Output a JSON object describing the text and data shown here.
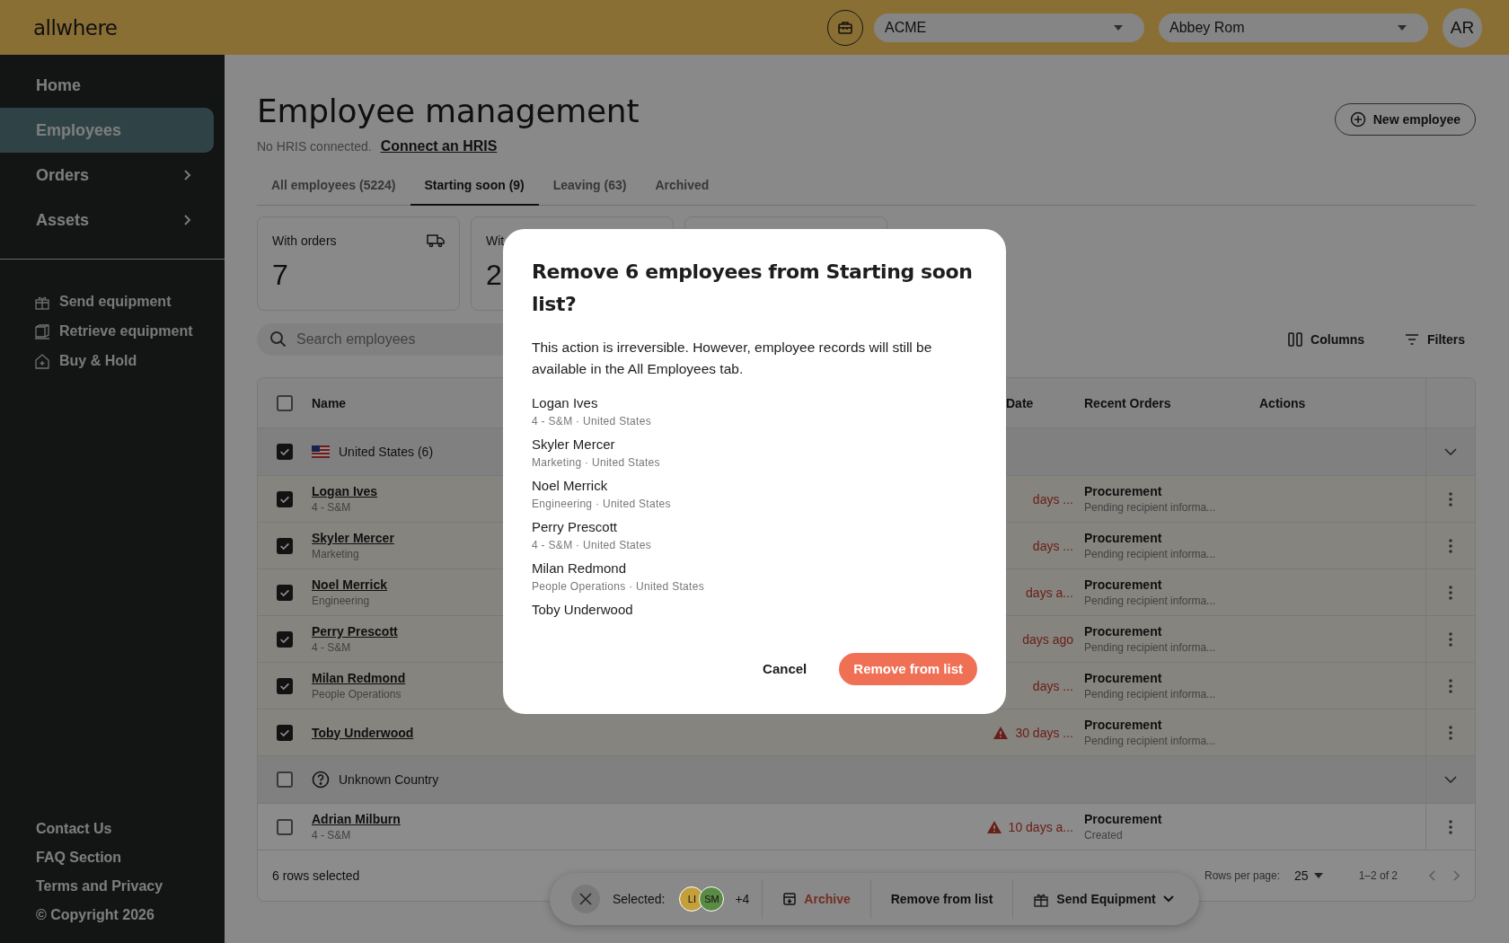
{
  "topbar": {
    "logo": "allwhere",
    "org_select": {
      "value": "ACME"
    },
    "user_select": {
      "value": "Abbey Rom"
    },
    "avatar": "AR"
  },
  "sidebar": {
    "items": [
      {
        "label": "Home",
        "selected": false,
        "expandable": false
      },
      {
        "label": "Employees",
        "selected": true,
        "expandable": false
      },
      {
        "label": "Orders",
        "selected": false,
        "expandable": true
      },
      {
        "label": "Assets",
        "selected": false,
        "expandable": true
      }
    ],
    "links": [
      {
        "label": "Send equipment",
        "kind": "gift"
      },
      {
        "label": "Retrieve equipment",
        "kind": "box"
      },
      {
        "label": "Buy & Hold",
        "kind": "house"
      }
    ],
    "footer_links": [
      "Contact Us",
      "FAQ Section",
      "Terms and Privacy",
      "© Copyright 2026"
    ]
  },
  "page": {
    "title": "Employee management",
    "hris_note": "No HRIS connected.",
    "hris_link": "Connect an HRIS",
    "new_button": "New employee"
  },
  "tabs": [
    {
      "label": "All employees (5224)",
      "selected": false
    },
    {
      "label": "Starting soon (9)",
      "selected": true
    },
    {
      "label": "Leaving (63)",
      "selected": false
    },
    {
      "label": "Archived",
      "selected": false
    }
  ],
  "stat_cards": [
    {
      "kind": "truck",
      "label": "With orders",
      "value": "7"
    },
    {
      "kind": "plain",
      "label": "Wit",
      "value": "2"
    },
    {
      "kind": "covered"
    }
  ],
  "toolbar": {
    "search": {
      "placeholder": "Search employees"
    },
    "columns_button": "Columns",
    "filters_button": "Filters"
  },
  "table": {
    "header_checked": false,
    "columns": [
      {
        "label": "Name"
      },
      {
        "label": "Date"
      },
      {
        "label": "Recent Orders"
      },
      {
        "label": "Actions"
      }
    ],
    "groups": [
      {
        "label": "United States (6)",
        "kind": "flag",
        "checked": true,
        "rows": [
          {
            "name": "Logan Ives",
            "department": "4 - S&M",
            "date": "days ...",
            "warning": false,
            "order": "Procurement",
            "order_status": "Pending recipient informa...",
            "checked": true
          },
          {
            "name": "Skyler Mercer",
            "department": "Marketing",
            "date": "days ...",
            "warning": false,
            "order": "Procurement",
            "order_status": "Pending recipient informa...",
            "checked": true
          },
          {
            "name": "Noel Merrick",
            "department": "Engineering",
            "date": "days a...",
            "warning": false,
            "order": "Procurement",
            "order_status": "Pending recipient informa...",
            "checked": true
          },
          {
            "name": "Perry Prescott",
            "department": "4 - S&M",
            "date": "days ago",
            "warning": false,
            "order": "Procurement",
            "order_status": "Pending recipient informa...",
            "checked": true
          },
          {
            "name": "Milan Redmond",
            "department": "People Operations",
            "date": "days ...",
            "warning": false,
            "order": "Procurement",
            "order_status": "Pending recipient informa...",
            "checked": true
          },
          {
            "name": "Toby Underwood",
            "date": "30 days ...",
            "warning": true,
            "order": "Procurement",
            "order_status": "Pending recipient informa...",
            "checked": true
          }
        ]
      },
      {
        "label": "Unknown Country",
        "kind": "unknown",
        "checked": false,
        "rows": [
          {
            "name": "Adrian Milburn",
            "department": "4 - S&M",
            "date": "10 days a...",
            "warning": true,
            "order": "Procurement",
            "order_status": "Created",
            "checked": false
          }
        ]
      }
    ],
    "footer": {
      "selected_count": "6 rows selected",
      "rows_per_page_label": "Rows per page:",
      "rows_per_page": "25",
      "range": "1–2 of 2"
    }
  },
  "selection_bar": {
    "label": "Selected:",
    "avatars": [
      {
        "initials": "LI",
        "color": "#c4a03c"
      },
      {
        "initials": "SM",
        "color": "#5a8a44"
      }
    ],
    "more": "+4",
    "actions": [
      {
        "label": "Archive",
        "kind": "archive"
      },
      {
        "label": "Remove from list",
        "kind": "plain"
      },
      {
        "label": "Send Equipment",
        "kind": "send"
      }
    ]
  },
  "dialog": {
    "title": "Remove 6 employees from Starting soon list?",
    "body": "This action is irreversible. However, employee records will still be available in the All Employees tab.",
    "employees": [
      {
        "name": "Logan Ives",
        "detail": "4 - S&M · United States"
      },
      {
        "name": "Skyler Mercer",
        "detail": "Marketing · United States"
      },
      {
        "name": "Noel Merrick",
        "detail": "Engineering · United States"
      },
      {
        "name": "Perry Prescott",
        "detail": "4 - S&M · United States"
      },
      {
        "name": "Milan Redmond",
        "detail": "People Operations · United States"
      },
      {
        "name": "Toby Underwood"
      }
    ],
    "cancel": "Cancel",
    "confirm": "Remove from list"
  }
}
